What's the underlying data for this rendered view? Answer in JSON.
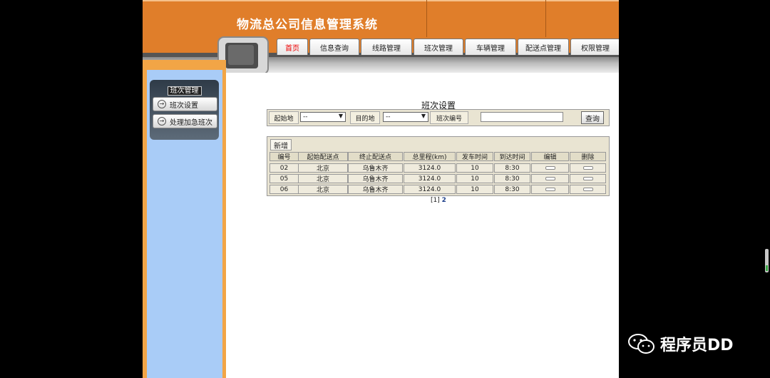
{
  "header": {
    "app_title": "物流总公司信息管理系统"
  },
  "nav": {
    "tabs": [
      "首页",
      "信息查询",
      "线路管理",
      "班次管理",
      "车辆管理",
      "配送点管理",
      "权限管理"
    ],
    "active": "首页"
  },
  "sidebar": {
    "title": "班次管理",
    "items": [
      "班次设置",
      "处理加急班次"
    ]
  },
  "main": {
    "title": "班次设置",
    "search": {
      "origin_label": "起始地",
      "origin_value": "--",
      "dest_label": "目的地",
      "dest_value": "--",
      "shift_no_label": "班次编号",
      "shift_no_value": "",
      "query_button": "查询"
    },
    "add_button": "新增",
    "table": {
      "headers": [
        "编号",
        "起始配送点",
        "终止配送点",
        "总里程(km)",
        "发车时间",
        "到达时间",
        "编辑",
        "删除"
      ],
      "rows": [
        [
          "02",
          "北京",
          "乌鲁木齐",
          "3124.0",
          "10",
          "8:30"
        ],
        [
          "05",
          "北京",
          "乌鲁木齐",
          "3124.0",
          "10",
          "8:30"
        ],
        [
          "06",
          "北京",
          "乌鲁木齐",
          "3124.0",
          "10",
          "8:30"
        ]
      ]
    },
    "pager": {
      "current": "[1]",
      "next": "2"
    }
  },
  "watermark": "程序员DD",
  "colors": {
    "header": "#e07e2a",
    "sidebar": "#a9ccf7",
    "sidebar_border": "#f2a546",
    "panel": "#e9e4d2"
  }
}
